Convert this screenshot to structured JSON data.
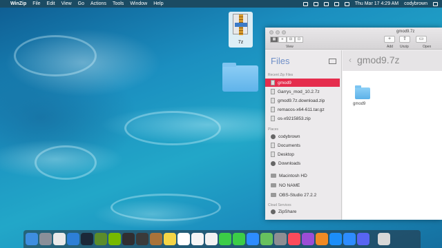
{
  "menubar": {
    "app": "WinZip",
    "menus": [
      "File",
      "Edit",
      "View",
      "Go",
      "Actions",
      "Tools",
      "Window",
      "Help"
    ],
    "datetime": "Thu Mar 17  4:29 AM",
    "user": "codybrown"
  },
  "desktop": {
    "file_label": "7z",
    "folder_label": ""
  },
  "window": {
    "title": "gmod9.7z",
    "toolbar": {
      "view_label": "View",
      "view_modes": [
        "▦",
        "≡",
        "⊟",
        "⊡"
      ],
      "add_label": "Add",
      "unzip_label": "Unzip",
      "open_label": "Open"
    },
    "sidebar": {
      "header": "Files",
      "sections": {
        "recent": "Recent Zip Files",
        "places": "Places",
        "cloud": "Cloud Services"
      },
      "recent": [
        "gmod9",
        "Garrys_mod_10.2.7z",
        "gmod9.7z.download.zip",
        "remacos-x64-611.tar.gz",
        "os-x9215853.zip"
      ],
      "places": [
        "codybrown",
        "Documents",
        "Desktop",
        "Downloads"
      ],
      "volumes": [
        "Macintosh HD",
        "NO NAME",
        "OBS-Studio 27.2.2"
      ],
      "cloud": [
        "ZipShare"
      ]
    },
    "main": {
      "path_title": "gmod9.7z",
      "items": [
        "gmod9"
      ]
    }
  },
  "dock": {
    "apps": [
      "finder",
      "launchpad",
      "chrome",
      "safari",
      "steam",
      "minecraft",
      "nvidia",
      "obs",
      "obs-2",
      "wood",
      "notes",
      "calendar",
      "reminders",
      "photos",
      "messages",
      "facetime",
      "zoom",
      "maps",
      "system-prefs",
      "music",
      "podcasts",
      "books",
      "appstore",
      "zoom-2",
      "discord",
      "trash"
    ],
    "colors": {
      "finder": "#3e8ee0",
      "launchpad": "#8a8f99",
      "chrome": "#e9e9e9",
      "safari": "#2d7fd6",
      "steam": "#1b2838",
      "minecraft": "#5b8c2a",
      "nvidia": "#76b900",
      "obs": "#302e31",
      "obs-2": "#3a3a3a",
      "wood": "#a8733a",
      "notes": "#f5d547",
      "calendar": "#ffffff",
      "reminders": "#f5f5f5",
      "photos": "#f2f2f2",
      "messages": "#3ccd47",
      "facetime": "#3ccd47",
      "zoom": "#2d8cff",
      "maps": "#67c15e",
      "system-prefs": "#8e8e93",
      "music": "#fb4b5b",
      "podcasts": "#9b4dd6",
      "books": "#f08a24",
      "appstore": "#1c8ef9",
      "zoom-2": "#2d8cff",
      "discord": "#5865f2",
      "trash": "#d8d8d8"
    }
  }
}
